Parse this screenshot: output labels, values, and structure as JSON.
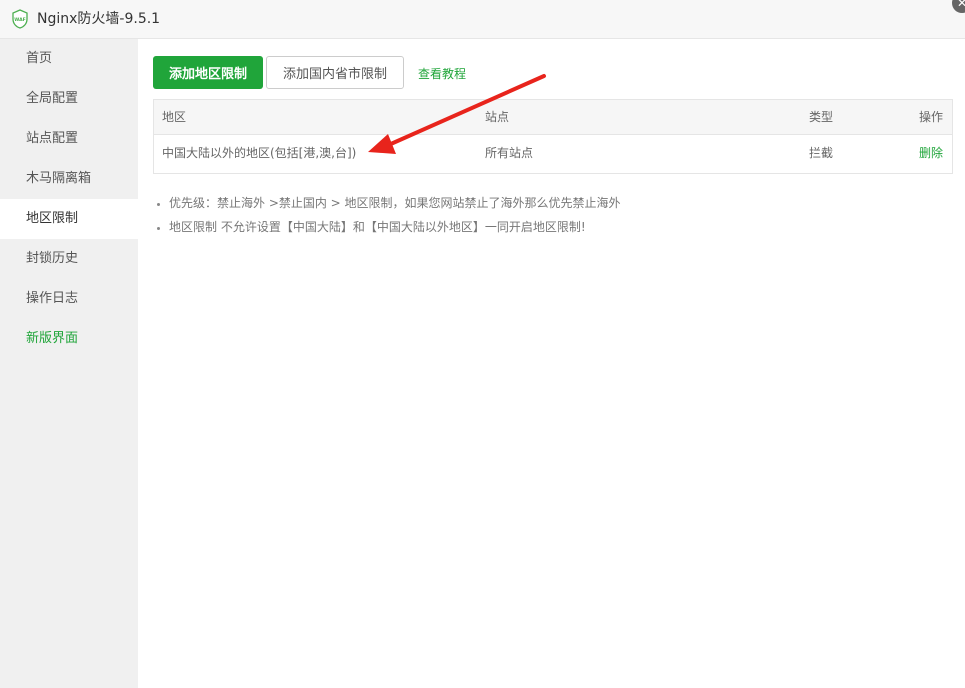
{
  "window": {
    "title": "Nginx防火墙-9.5.1",
    "close_glyph": "✕"
  },
  "sidebar": {
    "items": [
      {
        "label": "首页"
      },
      {
        "label": "全局配置"
      },
      {
        "label": "站点配置"
      },
      {
        "label": "木马隔离箱"
      },
      {
        "label": "地区限制",
        "active": true
      },
      {
        "label": "封锁历史"
      },
      {
        "label": "操作日志"
      },
      {
        "label": "新版界面",
        "accent": true
      }
    ]
  },
  "toolbar": {
    "add_region_label": "添加地区限制",
    "add_province_label": "添加国内省市限制",
    "tutorial_label": "查看教程"
  },
  "table": {
    "headers": [
      "地区",
      "站点",
      "类型",
      "操作"
    ],
    "rows": [
      {
        "region": "中国大陆以外的地区(包括[港,澳,台])",
        "site": "所有站点",
        "type": "拦截",
        "action": "删除"
      }
    ]
  },
  "notes": [
    "优先级：禁止海外 >禁止国内 > 地区限制，如果您网站禁止了海外那么优先禁止海外",
    "地区限制 不允许设置【中国大陆】和【中国大陆以外地区】一同开启地区限制!"
  ],
  "colors": {
    "accent": "#20a53a",
    "annotation_arrow": "#e8241c",
    "sidebar_bg": "#f0f0f0"
  }
}
